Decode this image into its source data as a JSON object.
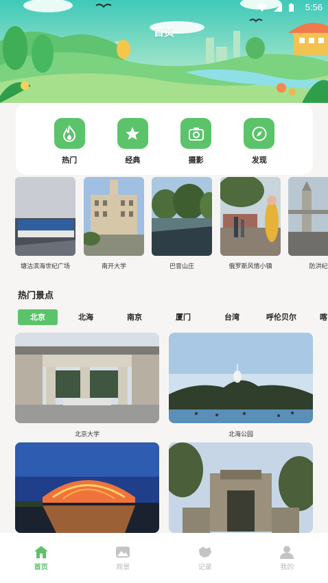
{
  "status_bar": {
    "time": "5:56"
  },
  "header": {
    "title": "首页"
  },
  "quick_actions": [
    {
      "label": "热门",
      "icon": "flame-icon"
    },
    {
      "label": "经典",
      "icon": "star-icon"
    },
    {
      "label": "摄影",
      "icon": "camera-icon"
    },
    {
      "label": "发现",
      "icon": "compass-icon"
    }
  ],
  "scenic_spots": [
    {
      "name": "塘沽滨海世纪广场"
    },
    {
      "name": "南开大学"
    },
    {
      "name": "巴音山庄"
    },
    {
      "name": "俄罗斯风情小镇"
    },
    {
      "name": "防洪纪"
    }
  ],
  "popular": {
    "title": "热门景点",
    "tabs": [
      "北京",
      "北海",
      "南京",
      "厦门",
      "台湾",
      "呼伦贝尔",
      "喀"
    ],
    "active_tab": "北京",
    "cards": [
      {
        "name": "北京大学"
      },
      {
        "name": "北海公园"
      },
      {
        "name": ""
      },
      {
        "name": ""
      }
    ]
  },
  "bottom_nav": [
    {
      "label": "首页",
      "icon": "home-icon",
      "active": true
    },
    {
      "label": "观景",
      "icon": "landscape-icon",
      "active": false
    },
    {
      "label": "记录",
      "icon": "map-icon",
      "active": false
    },
    {
      "label": "我的",
      "icon": "user-icon",
      "active": false
    }
  ],
  "colors": {
    "accent": "#5bc36a",
    "background": "#f7f5f3",
    "inactive": "#b8b8b8"
  }
}
